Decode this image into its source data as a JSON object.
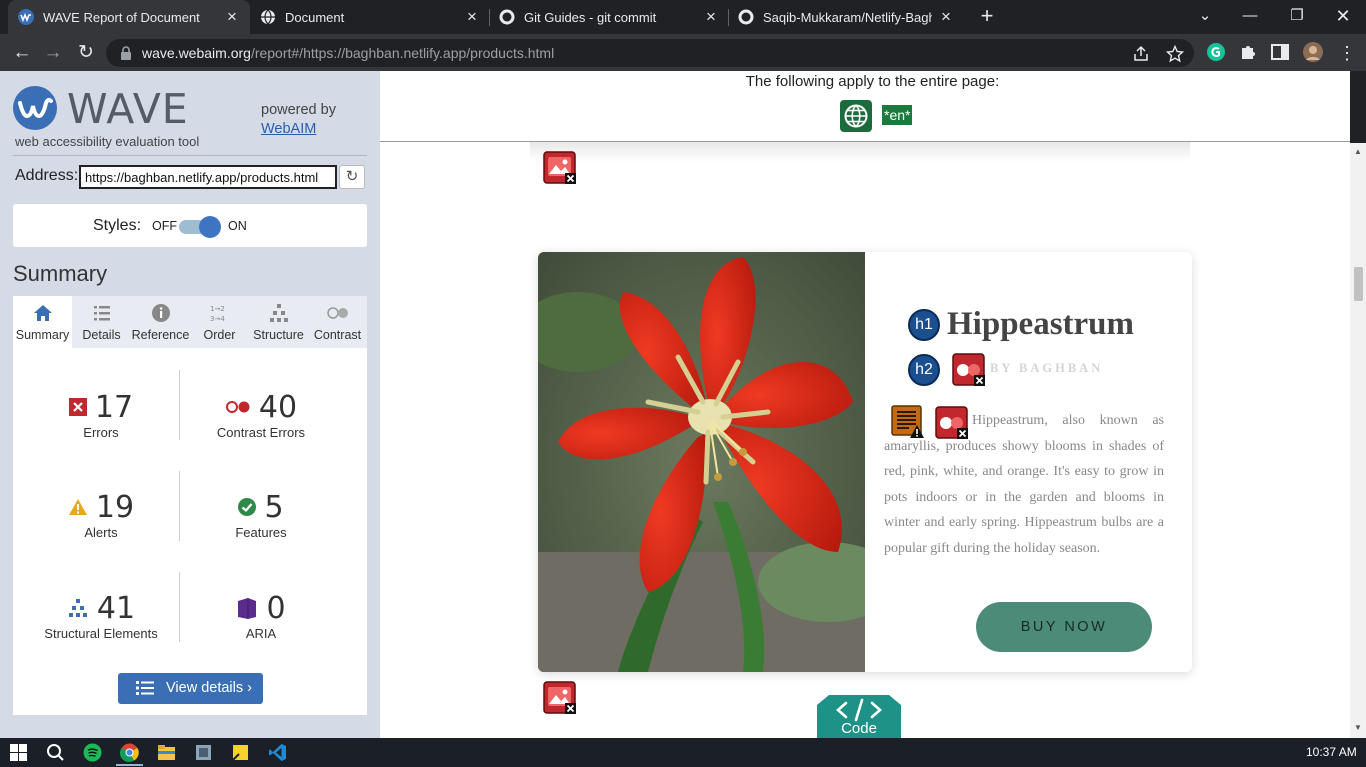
{
  "browser": {
    "tabs": [
      {
        "title": "WAVE Report of Document",
        "active": true
      },
      {
        "title": "Document",
        "active": false
      },
      {
        "title": "Git Guides - git commit",
        "active": false
      },
      {
        "title": "Saqib-Mukkaram/Netlify-Baghban",
        "active": false
      }
    ],
    "new_tab_label": "+",
    "url_host": "wave.webaim.org",
    "url_path": "/report#/https://baghban.netlify.app/products.html"
  },
  "wave": {
    "logo_text": "WAVE",
    "tagline": "web accessibility evaluation tool",
    "powered_by": "powered by",
    "powered_link": "WebAIM",
    "address_label": "Address:",
    "address_value": "https://baghban.netlify.app/products.html",
    "styles_label": "Styles:",
    "styles_off": "OFF",
    "styles_on": "ON",
    "styles_enabled": true,
    "summary_title": "Summary",
    "tabs": [
      {
        "label": "Summary",
        "icon": "home-icon",
        "active": true
      },
      {
        "label": "Details",
        "icon": "list-icon",
        "active": false
      },
      {
        "label": "Reference",
        "icon": "info-icon",
        "active": false
      },
      {
        "label": "Order",
        "icon": "order-icon",
        "active": false
      },
      {
        "label": "Structure",
        "icon": "structure-icon",
        "active": false
      },
      {
        "label": "Contrast",
        "icon": "contrast-icon",
        "active": false
      }
    ],
    "stats": {
      "errors": {
        "count": "17",
        "label": "Errors",
        "color": "#c0282d"
      },
      "contrast_errors": {
        "count": "40",
        "label": "Contrast Errors",
        "color": "#c0282d"
      },
      "alerts": {
        "count": "19",
        "label": "Alerts",
        "color": "#e8a81e"
      },
      "features": {
        "count": "5",
        "label": "Features",
        "color": "#2f8a4a"
      },
      "structural": {
        "count": "41",
        "label": "Structural Elements",
        "color": "#3a6eb5"
      },
      "aria": {
        "count": "0",
        "label": "ARIA",
        "color": "#5a2d8c"
      }
    },
    "view_details": "View details ›"
  },
  "page": {
    "applies_text": "The following apply to the entire page:",
    "lang_badge": "*en*",
    "product": {
      "h1_badge": "h1",
      "h2_badge": "h2",
      "title": "Hippeastrum",
      "byline": "BY BAGHBAN",
      "description": "Hippeastrum, also known as amaryllis, produces showy blooms in shades of red, pink, white, and orange. It's easy to grow in pots indoors or in the garden and blooms in winter and early spring. Hippeastrum bulbs are a popular gift during the holiday season.",
      "button": "BUY NOW"
    },
    "code_label": "Code"
  },
  "taskbar": {
    "time": "10:37 AM"
  }
}
